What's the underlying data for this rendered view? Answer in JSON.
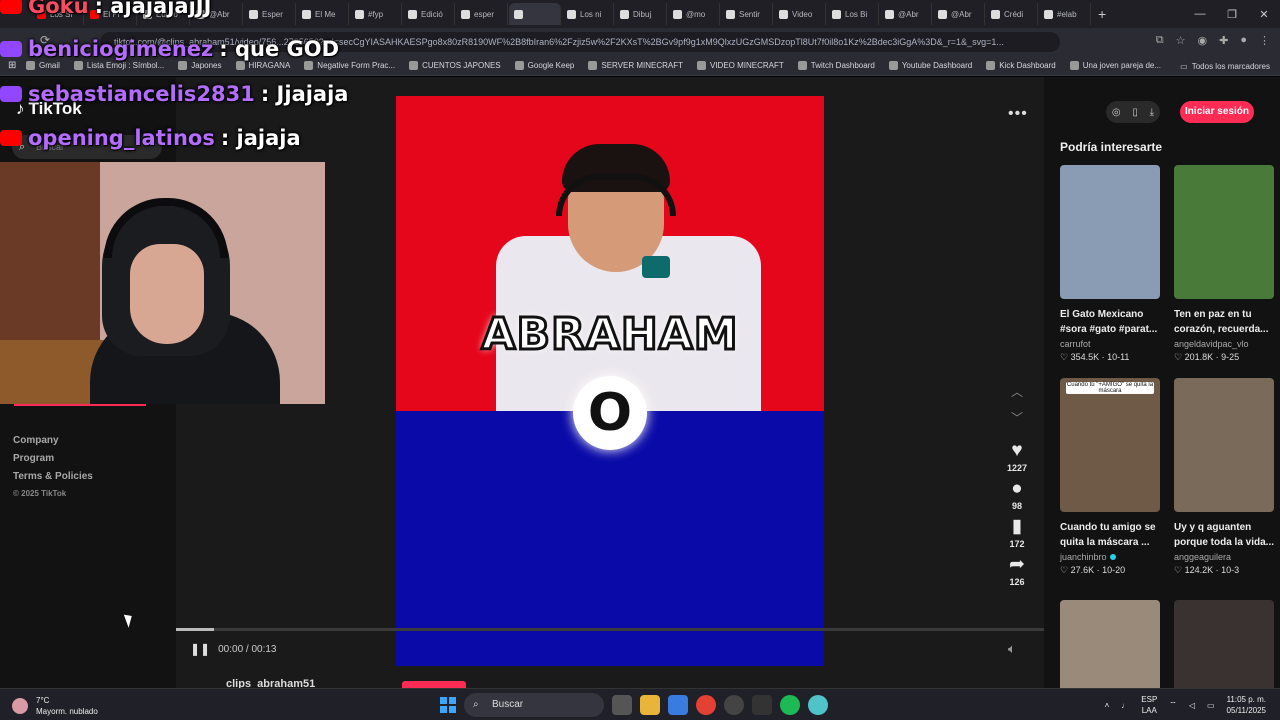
{
  "browser": {
    "tabs": [
      "Los Si",
      "El Pr",
      "Edició",
      "@Abr",
      "Esper",
      "El Me",
      "#fyp",
      "Edició",
      "esper",
      "",
      "Los ni",
      "Dibuj",
      "@mo",
      "Sentir",
      "Video",
      "Los Bi",
      "@Abr",
      "@Abr",
      "Crédi",
      "#elab"
    ],
    "active_tab_index": 9,
    "url": "tiktok.com/@clips_abraham51/video/756...2725650?_d=secCgYIASAHKAESPgo8x80zR8190WF%2B8fbIran6%2Fzjiz5w%2F2KXsT%2BGv9pf9g1xM9QlxzUGzGMSDzopTl8Ut7f0il8o1Kz%2Bdec3iGgA%3D&_r=1&_svg=1...",
    "bookmarks": [
      "Gmail",
      "Lista Emoji : Símbol...",
      "Japones",
      "HIRAGANA",
      "Negative Form Prac...",
      "CUENTOS JAPONES",
      "Google Keep",
      "SERVER MINECRAFT",
      "VIDEO MINECRAFT",
      "Twitch Dashboard",
      "Youtube Dashboard",
      "Kick Dashboard",
      "Una joven pareja de..."
    ],
    "bookmarks_all": "Todos los marcadores"
  },
  "tiktok": {
    "logo": "TikTok",
    "search_placeholder": "Buscar",
    "footer_links": [
      "Company",
      "Program",
      "Terms & Policies"
    ],
    "copyright": "© 2025 TikTok",
    "video": {
      "title_text": "ABRAHAM",
      "circle_text": "O",
      "likes": "1227",
      "comments": "98",
      "saves": "172",
      "shares": "126",
      "time": "00:00 / 00:13",
      "progress": 0.044,
      "author": "clips_abraham51"
    },
    "login_button": "Iniciar sesión",
    "recommend_heading": "Podría interesarte",
    "cards": [
      {
        "title": "El Gato Mexicano\n#sora #gato #parat...",
        "user": "carrufot",
        "verified": false,
        "stats": "♡ 354.5K · 10-11",
        "caption": ""
      },
      {
        "title": "Ten en paz en tu\ncorazón, recuerda...",
        "user": "angeldavidpac_vlo",
        "verified": false,
        "stats": "♡ 201.8K · 9-25",
        "caption": ""
      },
      {
        "title": "Cuando tu amigo se\nquita la máscara ...",
        "user": "juanchinbro",
        "verified": true,
        "stats": "♡ 27.6K · 10-20",
        "caption": "Cuando tú \"+AMIGO\" se quita la máscara"
      },
      {
        "title": "Uy y q aguanten\nporque toda la vida...",
        "user": "anggeaguilera",
        "verified": false,
        "stats": "♡ 124.2K · 10-3",
        "caption": ""
      },
      {
        "title": "",
        "user": "",
        "verified": false,
        "stats": "",
        "caption": ""
      },
      {
        "title": "",
        "user": "",
        "verified": false,
        "stats": "",
        "caption": ""
      }
    ]
  },
  "stream_chat": [
    {
      "platform": "youtube",
      "user": "Goku",
      "message": ": ajajajajJJ"
    },
    {
      "platform": "twitch",
      "user": "beniciogimenez",
      "message": ": que GOD"
    },
    {
      "platform": "twitch",
      "user": "sebastiancelis2831",
      "message": ": Jjajaja"
    },
    {
      "platform": "youtube",
      "user": "opening_latinos",
      "message": ": jajaja"
    }
  ],
  "taskbar": {
    "temperature": "7°C",
    "weather": "Mayorm. nublado",
    "search": "Buscar",
    "lang1": "ESP",
    "lang2": "LAA",
    "time": "11:05 p. m.",
    "date": "05/11/2025"
  },
  "colors": {
    "accent": "#fe2c55",
    "twitch": "#9146ff",
    "youtube": "#ff0000",
    "video_red": "#e6061b",
    "video_blue": "#0a0aa8"
  }
}
